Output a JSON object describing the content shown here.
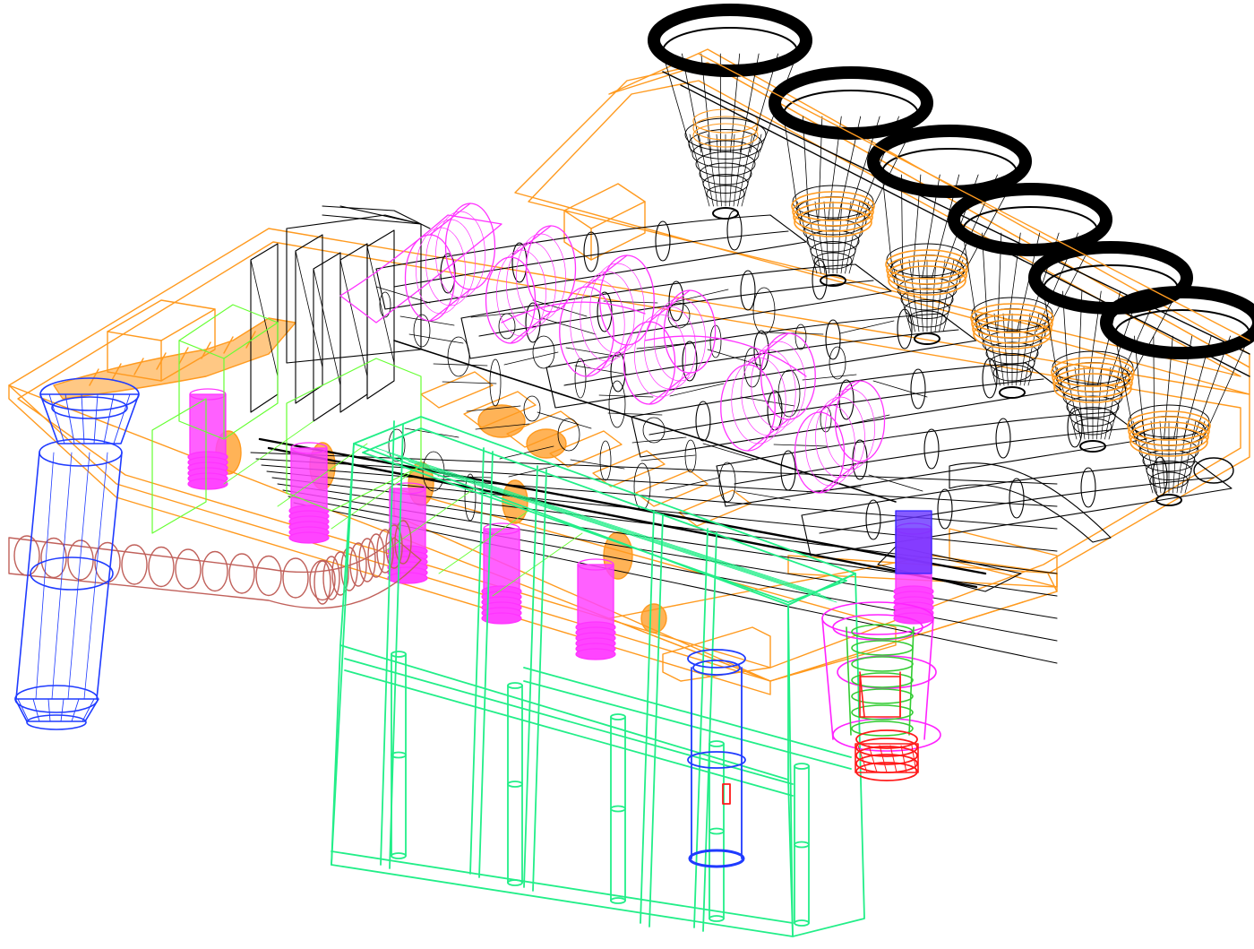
{
  "view": {
    "background": "#ffffff",
    "render_style": "wireframe"
  },
  "colors": {
    "frame": "#ff9a1f",
    "funnels": "#000000",
    "pipes": "#000000",
    "cylinders": "#ff33ff",
    "cylinder_fill": "#ff44ff",
    "blocks": "#66ff33",
    "cabinet": "#22ee88",
    "column": "#1f3bff",
    "hose": "#c0605a",
    "rod": "#1f3bff",
    "right_column": "#ff22ff",
    "right_inner": "#33cc33",
    "red_parts": "#ff1a1a",
    "connectors": "#ff9a1f"
  },
  "parts": [
    {
      "id": "frame",
      "icon": "frame-icon"
    },
    {
      "id": "funnels",
      "count": 6
    },
    {
      "id": "cylinders",
      "count": 6
    },
    {
      "id": "cabinet"
    },
    {
      "id": "left-column"
    },
    {
      "id": "hose"
    },
    {
      "id": "right-column"
    },
    {
      "id": "rod"
    }
  ]
}
